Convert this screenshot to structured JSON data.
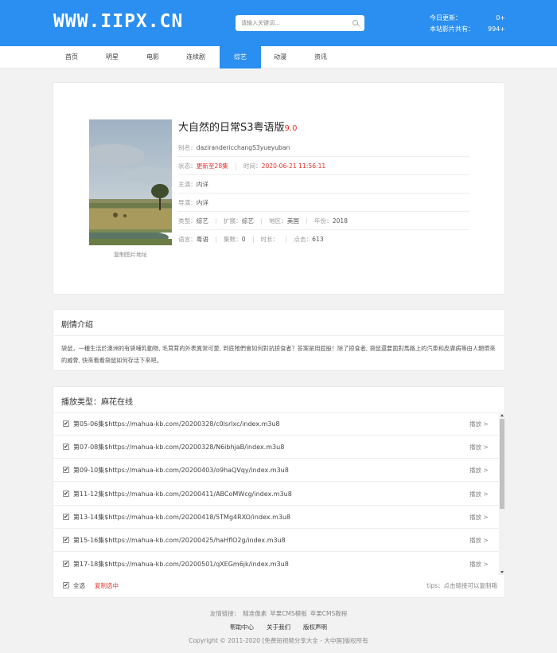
{
  "header": {
    "logo": "WWW.IIPX.CN",
    "search_placeholder": "请输入关键词...",
    "stats": [
      {
        "label": "今日更新：",
        "value": "0+"
      },
      {
        "label": "本站影片共有：",
        "value": "994+"
      }
    ]
  },
  "nav": {
    "items": [
      "首页",
      "明星",
      "电影",
      "连续剧",
      "综艺",
      "动漫",
      "资讯"
    ],
    "active_index": 4
  },
  "detail": {
    "title": "大自然的日常S3粤语版",
    "score": "9.0",
    "poster_link": "复制图片地址",
    "alias_label": "别名：",
    "alias": "dazirandericchangS3yueyuban",
    "status_label": "状态：",
    "status": "更新至28集",
    "time_label": "时间：",
    "time": "2020-06-21 11:56:11",
    "actor_label": "主演：",
    "actor": "内详",
    "director_label": "导演：",
    "director": "内详",
    "type_label": "类型：",
    "type": "综艺",
    "ext_label": "扩展：",
    "ext": "综艺",
    "region_label": "地区：",
    "region": "美国",
    "year_label": "年份：",
    "year": "2018",
    "lang_label": "语言：",
    "lang": "粤语",
    "episodes_label": "集数：",
    "episodes": "0",
    "duration_label": "时长：",
    "duration": "",
    "clicks_label": "点击：",
    "clicks": "613"
  },
  "synopsis": {
    "heading": "剧情介绍",
    "text": "袋鼠，一種生活於澳洲的有袋哺乳動物, 毛茸茸的外表異常可愛, 到底牠們會如何對抗掠食者？答案是用屁股！除了掠食者, 袋鼠還要面對馬路上的汽車和皮膚病等由人類帶來的威脅, 快來看看袋鼠如何存活下來吧。"
  },
  "playlist": {
    "heading": "播放类型：麻花在线",
    "play_label": "播放 >",
    "episodes": [
      "第05-06集$https://mahua-kb.com/20200328/c0lsrlxc/index.m3u8",
      "第07-08集$https://mahua-kb.com/20200328/N6ibhjaB/index.m3u8",
      "第09-10集$https://mahua-kb.com/20200403/o9haQVqy/index.m3u8",
      "第11-12集$https://mahua-kb.com/20200411/ABCoMWcg/index.m3u8",
      "第13-14集$https://mahua-kb.com/20200418/5TMg4RXO/index.m3u8",
      "第15-16集$https://mahua-kb.com/20200425/haHflO2g/index.m3u8",
      "第17-18集$https://mahua-kb.com/20200501/qXEGm6jk/index.m3u8"
    ],
    "select_all": "全选",
    "copy_selected": "复制选中",
    "tips": "tips：点击链接可以复制哦"
  },
  "footer": {
    "friend_label": "友情链接：",
    "friend_links": [
      "精准像素",
      "苹果CMS模板",
      "苹果CMS教程"
    ],
    "links": [
      "帮助中心",
      "关于我们",
      "版权声明"
    ],
    "copyright": "Copyright © 2011-2020 [免费短视频分享大全 - 大中国]版权所有"
  }
}
